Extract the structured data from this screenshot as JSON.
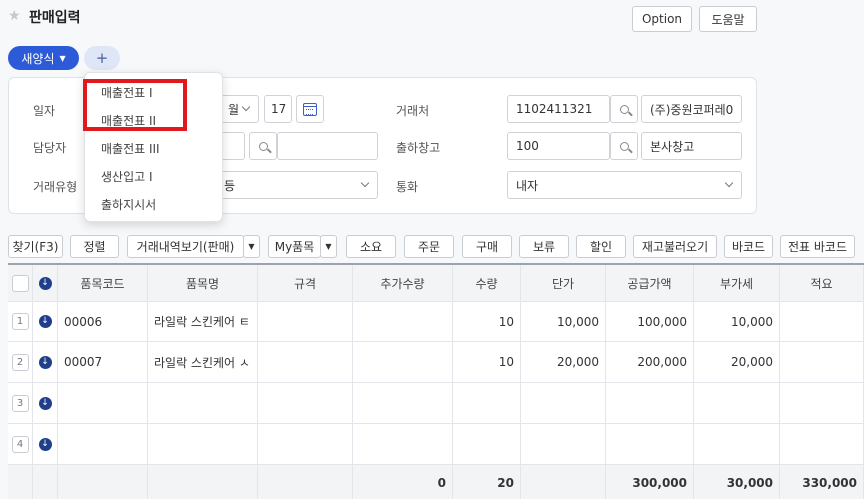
{
  "header": {
    "title": "판매입력",
    "option_label": "Option",
    "help_label": "도움말"
  },
  "tabs": {
    "new_form_label": "새양식",
    "add_label": "+"
  },
  "form": {
    "date_label": "일자",
    "date_month_partial": "월",
    "date_day": "17",
    "manager_label": "담당자",
    "trade_type_label": "거래유형",
    "trade_type_value_partial": "등",
    "customer_label": "거래처",
    "customer_code": "1102411321",
    "customer_name": "(주)중원코퍼레0",
    "warehouse_label": "출하창고",
    "warehouse_code": "100",
    "warehouse_name": "본사창고",
    "currency_label": "통화",
    "currency_value": "내자"
  },
  "dropdown": {
    "items": [
      "매출전표 I",
      "매출전표 II",
      "매출전표 III",
      "생산입고 I",
      "출하지시서"
    ]
  },
  "toolbar": {
    "find": "찾기(F3)",
    "sort": "정렬",
    "history": "거래내역보기(판매)",
    "my_items": "My품목",
    "consume": "소요",
    "order": "주문",
    "purchase": "구매",
    "hold": "보류",
    "discount": "할인",
    "stock_load": "재고불러오기",
    "barcode": "바코드",
    "slip_barcode": "전표 바코드"
  },
  "grid": {
    "headers": [
      "품목코드",
      "품목명",
      "규격",
      "추가수량",
      "수량",
      "단가",
      "공급가액",
      "부가세",
      "적요"
    ],
    "rows": [
      {
        "no": "1",
        "code": "00006",
        "name": "라일락 스킨케어 ㅌ",
        "spec": "",
        "extra_qty": "",
        "qty": "10",
        "price": "10,000",
        "supply": "100,000",
        "vat": "10,000",
        "memo": ""
      },
      {
        "no": "2",
        "code": "00007",
        "name": "라일락 스킨케어 ㅅ",
        "spec": "",
        "extra_qty": "",
        "qty": "10",
        "price": "20,000",
        "supply": "200,000",
        "vat": "20,000",
        "memo": ""
      },
      {
        "no": "3",
        "code": "",
        "name": "",
        "spec": "",
        "extra_qty": "",
        "qty": "",
        "price": "",
        "supply": "",
        "vat": "",
        "memo": ""
      },
      {
        "no": "4",
        "code": "",
        "name": "",
        "spec": "",
        "extra_qty": "",
        "qty": "",
        "price": "",
        "supply": "",
        "vat": "",
        "memo": ""
      }
    ],
    "totals": {
      "extra_qty": "0",
      "qty": "20",
      "price": "",
      "supply": "300,000",
      "vat": "30,000",
      "memo": "330,000"
    }
  },
  "colors": {
    "primary": "#2d5bd7",
    "highlight": "#e0191f",
    "download_icon": "#1f3f8a"
  }
}
